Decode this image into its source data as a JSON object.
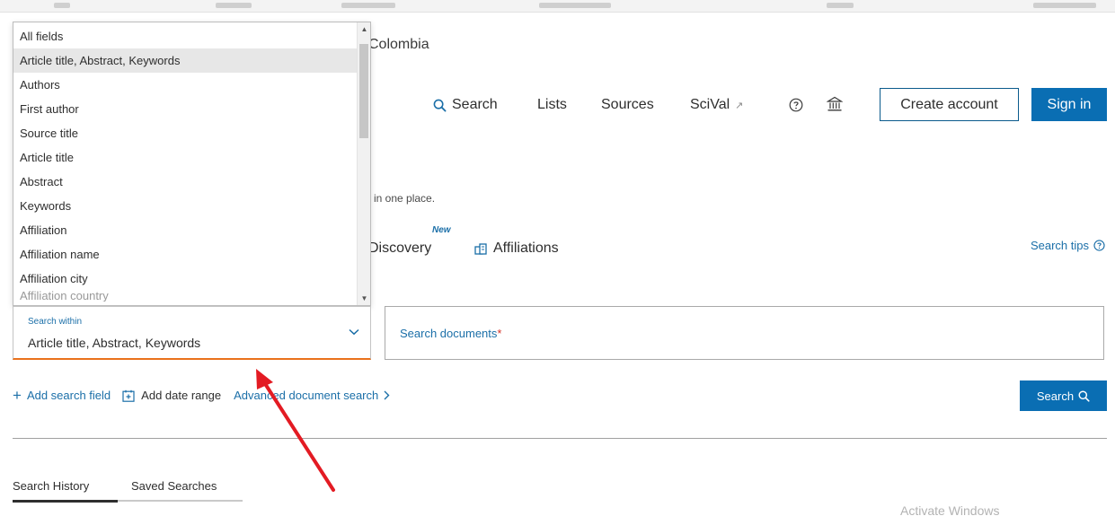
{
  "header": {
    "brand_text": "Colombia",
    "nav": {
      "search": "Search",
      "lists": "Lists",
      "sources": "Sources",
      "scival": "SciVal",
      "scival_ext_glyph": "↗"
    },
    "create_account": "Create account",
    "sign_in": "Sign in"
  },
  "hero": {
    "tagline": "l in one place."
  },
  "search_tabs": {
    "discovery": "Discovery",
    "new_badge": "New",
    "affiliations": "Affiliations",
    "search_tips": "Search tips"
  },
  "dropdown": {
    "items": [
      "All fields",
      "Article title, Abstract, Keywords",
      "Authors",
      "First author",
      "Source title",
      "Article title",
      "Abstract",
      "Keywords",
      "Affiliation",
      "Affiliation name",
      "Affiliation city",
      "Affiliation country"
    ],
    "selected_index": 1
  },
  "search_within": {
    "label": "Search within",
    "value": "Article title, Abstract, Keywords"
  },
  "document_search": {
    "label": "Search documents",
    "required_mark": "*",
    "value": ""
  },
  "actions": {
    "add_search_field": "Add search field",
    "add_date_range": "Add date range",
    "advanced_search": "Advanced document search",
    "search_button": "Search"
  },
  "history_tabs": {
    "search_history": "Search History",
    "saved_searches": "Saved Searches"
  },
  "watermark": "Activate Windows",
  "colors": {
    "accent_blue": "#0a6eb3",
    "link_blue": "#1b6fa8",
    "focus_orange": "#e9711c",
    "annotation_red": "#e31b23"
  },
  "icons": {
    "search": "magnifier-icon",
    "help": "question-circle-icon",
    "institution": "institution-icon",
    "affiliations": "building-icon",
    "calendar": "calendar-icon",
    "chevron": "chevron-down-icon"
  }
}
